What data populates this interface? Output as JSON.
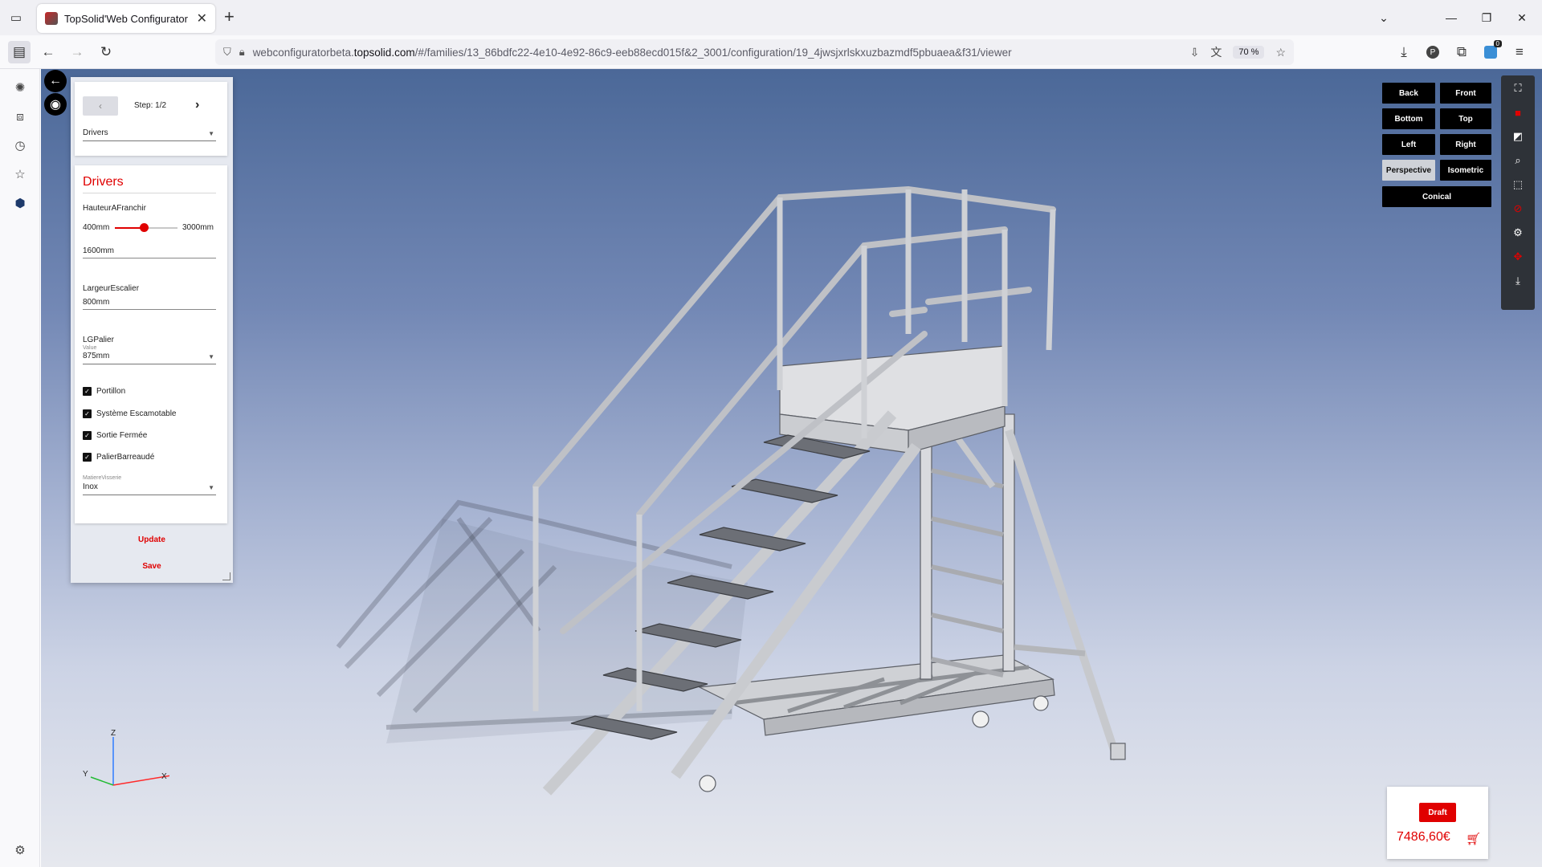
{
  "browser": {
    "tab_title": "TopSolid'Web Configurator",
    "url_prefix": "webconfiguratorbeta.",
    "url_host": "topsolid.com",
    "url_path": "/#/families/13_86bdfc22-4e10-4e92-86c9-eeb88ecd015f&2_3001/configuration/19_4jwsjxrlskxuzbazmdf5pbuaea&f31/viewer",
    "zoom": "70 %",
    "extension_badge": "0"
  },
  "panel": {
    "step_prev": "‹",
    "step_label": "Step: 1/2",
    "step_next": "›",
    "step_select": "Drivers",
    "section_title": "Drivers",
    "height_label": "HauteurAFranchir",
    "height_min": "400mm",
    "height_max": "3000mm",
    "height_value": "1600mm",
    "height_fraction": 0.462,
    "width_label": "LargeurEscalier",
    "width_value": "800mm",
    "landing_label": "LGPalier",
    "landing_sub": "Value",
    "landing_value": "875mm",
    "checkboxes": [
      {
        "label": "Portillon",
        "checked": true
      },
      {
        "label": "Système Escamotable",
        "checked": true
      },
      {
        "label": "Sortie Fermée",
        "checked": true
      },
      {
        "label": "PalierBarreaudé",
        "checked": true
      }
    ],
    "material_label": "MatiereVisserie",
    "material_value": "Inox",
    "update_label": "Update",
    "save_label": "Save"
  },
  "views": {
    "back": "Back",
    "front": "Front",
    "bottom": "Bottom",
    "top": "Top",
    "left": "Left",
    "right": "Right",
    "perspective": "Perspective",
    "isometric": "Isometric",
    "conical": "Conical",
    "active": "Perspective"
  },
  "axes": {
    "z": "Z",
    "y": "Y",
    "x": "X"
  },
  "price": {
    "draft_label": "Draft",
    "amount": "7486,60€"
  },
  "colors": {
    "accent": "#e00000",
    "viewer_top": "#4b6898",
    "viewer_bottom": "#e6e8ee"
  }
}
